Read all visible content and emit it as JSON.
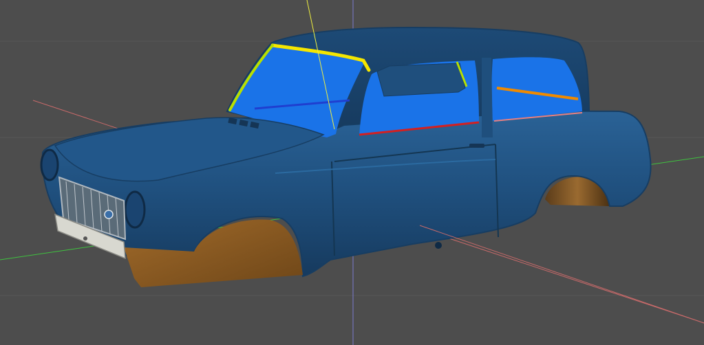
{
  "viewport": {
    "background": "#4d4d4d",
    "grid_line_color": "#5a5a5a"
  },
  "axes": {
    "x_axis_color": "#c86a6a",
    "y_axis_color": "#3fc43f",
    "z_axis_color": "#7a7ad0",
    "selection_line_color": "#f0f040"
  },
  "model": {
    "body_color": "#1f4f7d",
    "body_shadow_color": "#163a5e",
    "body_highlight_color": "#2a6296",
    "window_color": "#1a73e8",
    "wheel_arch_color": "#8a5a22",
    "trim_yellow": "#f5e600",
    "trim_green": "#b8e000",
    "trim_orange": "#f08a00",
    "trim_red": "#d42020",
    "grille_color": "#9aa2a8",
    "bumper_color": "#d8d8d0"
  }
}
